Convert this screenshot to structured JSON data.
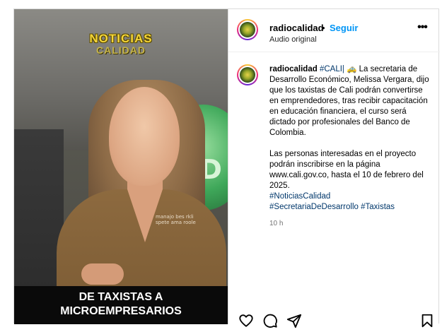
{
  "video": {
    "logo_line1": "NOTICIAS",
    "logo_line2": "CALIDAD",
    "caption_line1": "DE TAXISTAS A",
    "caption_line2": "MICROEMPRESARIOS",
    "background_sign_text": "AD",
    "shirt_text": "manajo bes rkli spete ama roole"
  },
  "header": {
    "username": "radiocalidad",
    "separator": "•",
    "follow_label": "Seguir",
    "audio_label": "Audio original",
    "more_label": "•••"
  },
  "post": {
    "author": "radiocalidad",
    "hashtag_cali": "#CALI|",
    "emoji": "🚕",
    "paragraph1": "La secretaria de Desarrollo Económico, Melissa Vergara, dijo que los taxistas de Cali podrán convertirse en emprendedores, tras recibir capacitación en educación financiera, el curso será dictado por profesionales del Banco de Colombia.",
    "paragraph2": "Las personas interesadas en el proyecto podrán inscribirse en la página www.cali.gov.co, hasta el 10 de febrero del 2025.",
    "hashtag1": "#NoticiasCalidad",
    "hashtag2": "#SecretariaDeDesarrollo",
    "hashtag3": "#Taxistas",
    "time": "10 h"
  },
  "actions": {
    "icons": [
      "heart-icon",
      "comment-icon",
      "share-icon",
      "bookmark-icon"
    ]
  },
  "colors": {
    "link_blue": "#0095f6",
    "hashtag_blue": "#00376b",
    "logo_yellow": "#f5d63a",
    "secondary_text": "#737373"
  }
}
